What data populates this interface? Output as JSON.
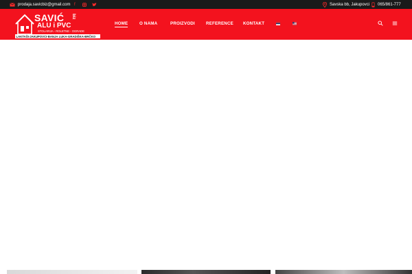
{
  "topbar": {
    "email": "prodaja.savicbiz@gmail.com",
    "social": [
      "facebook-icon",
      "instagram-icon",
      "twitter-icon"
    ],
    "address": "Savska bb, Jakupovci",
    "phone": "065/861-777"
  },
  "logo": {
    "brand": "SAVIĆ",
    "brand_suffix": "biz",
    "product_line": "ALU i PVC",
    "services": "STOLARIJA - ROLETNE - OGRADE",
    "locations": "LAKTAŠI-JAKUPOVCI-BANJA LUKA-GRADIŠKA-BRČKO"
  },
  "nav": {
    "items": [
      "HOME",
      "O NAMA",
      "PROIZVODI",
      "REFERENCE",
      "KONTAKT"
    ],
    "active_index": 0
  },
  "colors": {
    "header_red": "#f3121e",
    "topbar_black": "#1a1a1a",
    "accent": "#ff2b2b"
  },
  "icons": {
    "email": "envelope-icon",
    "address": "map-pin-icon",
    "phone": "mobile-phone-icon",
    "search": "search-icon",
    "menu": "hamburger-menu-icon",
    "flag_1": "serbian-flag-icon",
    "flag_2": "english-flag-icon"
  }
}
